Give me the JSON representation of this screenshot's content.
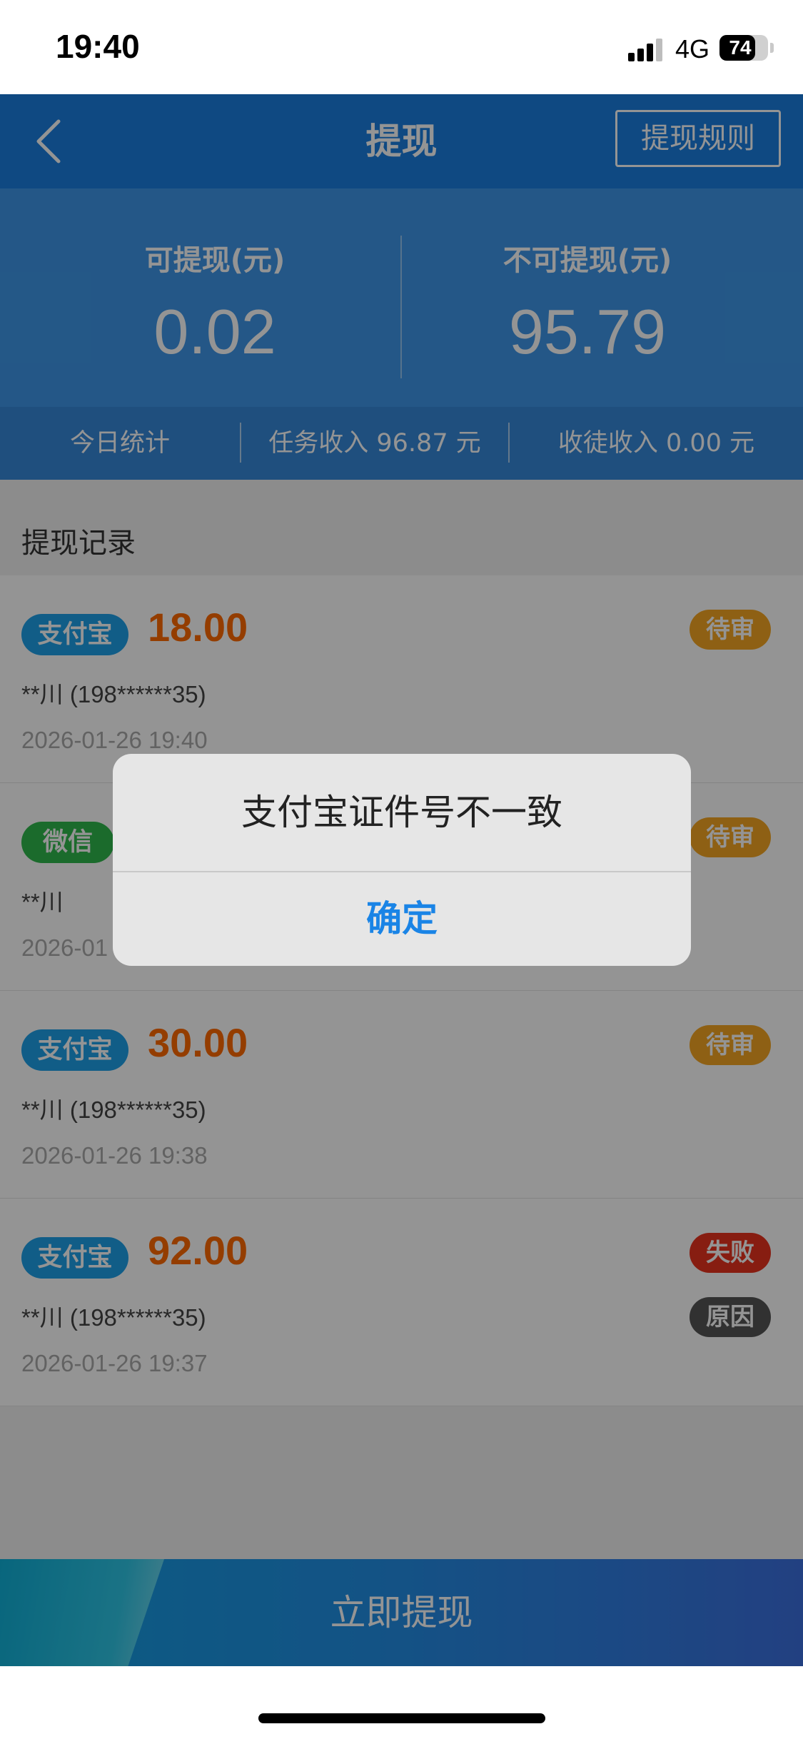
{
  "status_bar": {
    "time": "19:40",
    "network": "4G",
    "battery": "74",
    "battery_level": 0.74
  },
  "nav": {
    "title": "提现",
    "rules_label": "提现规则",
    "back_icon": "chevron-left-icon"
  },
  "balance": {
    "available_label": "可提现(元)",
    "available_value": "0.02",
    "unavailable_label": "不可提现(元)",
    "unavailable_value": "95.79"
  },
  "stats": {
    "today_label": "今日统计",
    "task_income": "任务收入 96.87 元",
    "apprentice_income": "收徒收入 0.00 元"
  },
  "records": {
    "title": "提现记录",
    "items": [
      {
        "method": "支付宝",
        "amount": "18.00",
        "status": "待审",
        "account": "**川 (198******35)",
        "time": "2026-01-26 19:40"
      },
      {
        "method": "微信",
        "amount": "",
        "status": "待审",
        "account": "**川",
        "time": "2026-01"
      },
      {
        "method": "支付宝",
        "amount": "30.00",
        "status": "待审",
        "account": "**川 (198******35)",
        "time": "2026-01-26 19:38"
      },
      {
        "method": "支付宝",
        "amount": "92.00",
        "status": "失败",
        "reason_label": "原因",
        "account": "**川 (198******35)",
        "time": "2026-01-26 19:37"
      }
    ]
  },
  "withdraw_button": {
    "label": "立即提现"
  },
  "alert": {
    "message": "支付宝证件号不一致",
    "confirm_label": "确定"
  },
  "colors": {
    "primary_blue": "#1a7fe0",
    "alipay_tag": "#1ea0e8",
    "wechat_tag": "#2fb84c",
    "amount": "#ff6a00",
    "pending": "#f5a623",
    "failed": "#e8321e",
    "reason": "#555555"
  }
}
